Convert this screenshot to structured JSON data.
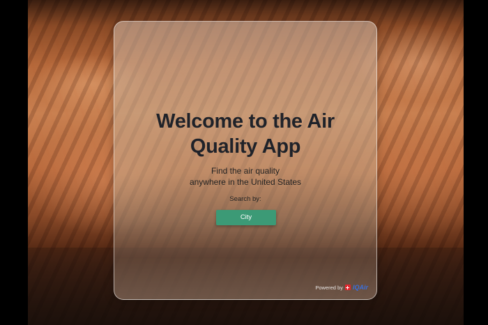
{
  "welcome": {
    "title": "Welcome to the Air Quality App",
    "subtitle_line1": "Find the air quality",
    "subtitle_line2": "anywhere in the United States",
    "search_label": "Search by:",
    "city_button_label": "City"
  },
  "footer": {
    "powered_by": "Powered by",
    "brand": "IQAir"
  },
  "colors": {
    "button": "#3c9a76",
    "title": "#1f2229",
    "brand": "#3b6fd9",
    "brand_mark": "#e0262d"
  }
}
